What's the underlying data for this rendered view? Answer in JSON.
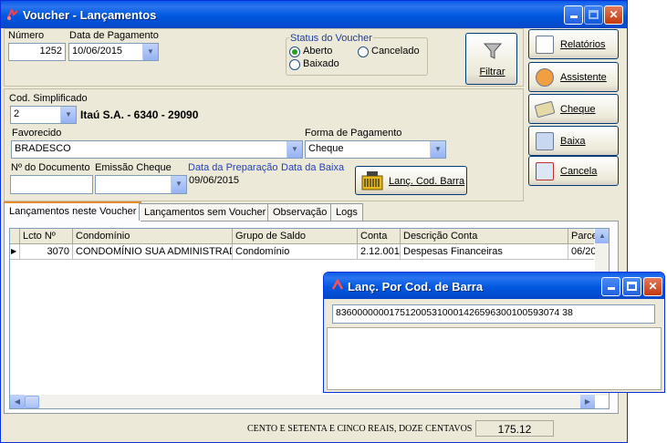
{
  "window": {
    "title": "Voucher - Lançamentos",
    "title_icon": "voucher-app-icon"
  },
  "header": {
    "numero_label": "Número",
    "numero_value": "1252",
    "data_pagamento_label": "Data de Pagamento",
    "data_pagamento_value": "10/06/2015",
    "status_group_label": "Status do Voucher",
    "status_options": [
      "Aberto",
      "Cancelado",
      "Baixado"
    ],
    "status_selected": "Aberto",
    "filter_button_label": "Filtrar"
  },
  "sidebar": {
    "buttons": [
      {
        "label": "Relatórios",
        "icon": "report-icon"
      },
      {
        "label": "Assistente",
        "icon": "assistant-icon"
      },
      {
        "label": "Cheque",
        "icon": "cheque-icon"
      },
      {
        "label": "Baixa",
        "icon": "voucher-baixa-icon"
      },
      {
        "label": "Cancela",
        "icon": "cancel-doc-icon"
      }
    ]
  },
  "form": {
    "cod_simplificado_label": "Cod. Simplificado",
    "cod_simplificado_value": "2",
    "bank_info": "Itaú S.A. - 6340 - 29090",
    "favorecido_label": "Favorecido",
    "favorecido_value": "BRADESCO",
    "forma_pagamento_label": "Forma de Pagamento",
    "forma_pagamento_value": "Cheque",
    "num_documento_label": "Nº do Documento",
    "num_documento_value": "",
    "emissao_cheque_label": "Emissão Cheque",
    "emissao_cheque_value": "",
    "data_preparacao_label": "Data da Preparação",
    "data_preparacao_value": "09/06/2015",
    "data_baixa_label": "Data da Baixa",
    "lanc_cod_barra_label": "Lanç. Cod. Barra"
  },
  "tabs": [
    "Lançamentos neste Voucher",
    "Lançamentos sem Voucher",
    "Observação",
    "Logs"
  ],
  "grid": {
    "columns": [
      "Lcto Nº",
      "Condomínio",
      "Grupo de Saldo",
      "Conta",
      "Descrição Conta",
      "Parce"
    ],
    "rows": [
      [
        "3070",
        "CONDOMÍNIO SUA ADMINISTRAD",
        "Condomínio",
        "2.12.001",
        "Despesas Financeiras",
        "06/20"
      ]
    ]
  },
  "footer": {
    "amount_words": "CENTO E SETENTA E CINCO REAIS, DOZE CENTAVOS",
    "amount_value": "175.12"
  },
  "dialog": {
    "title": "Lanç. Por Cod. de Barra",
    "barcode_value": "836000000017512005310001426596300100593074 38"
  },
  "colors": {
    "titlebar": "#0058e0",
    "window_bg": "#ece9d8",
    "link_blue": "#1f3fbf",
    "status_label": "#1c3c9c"
  }
}
